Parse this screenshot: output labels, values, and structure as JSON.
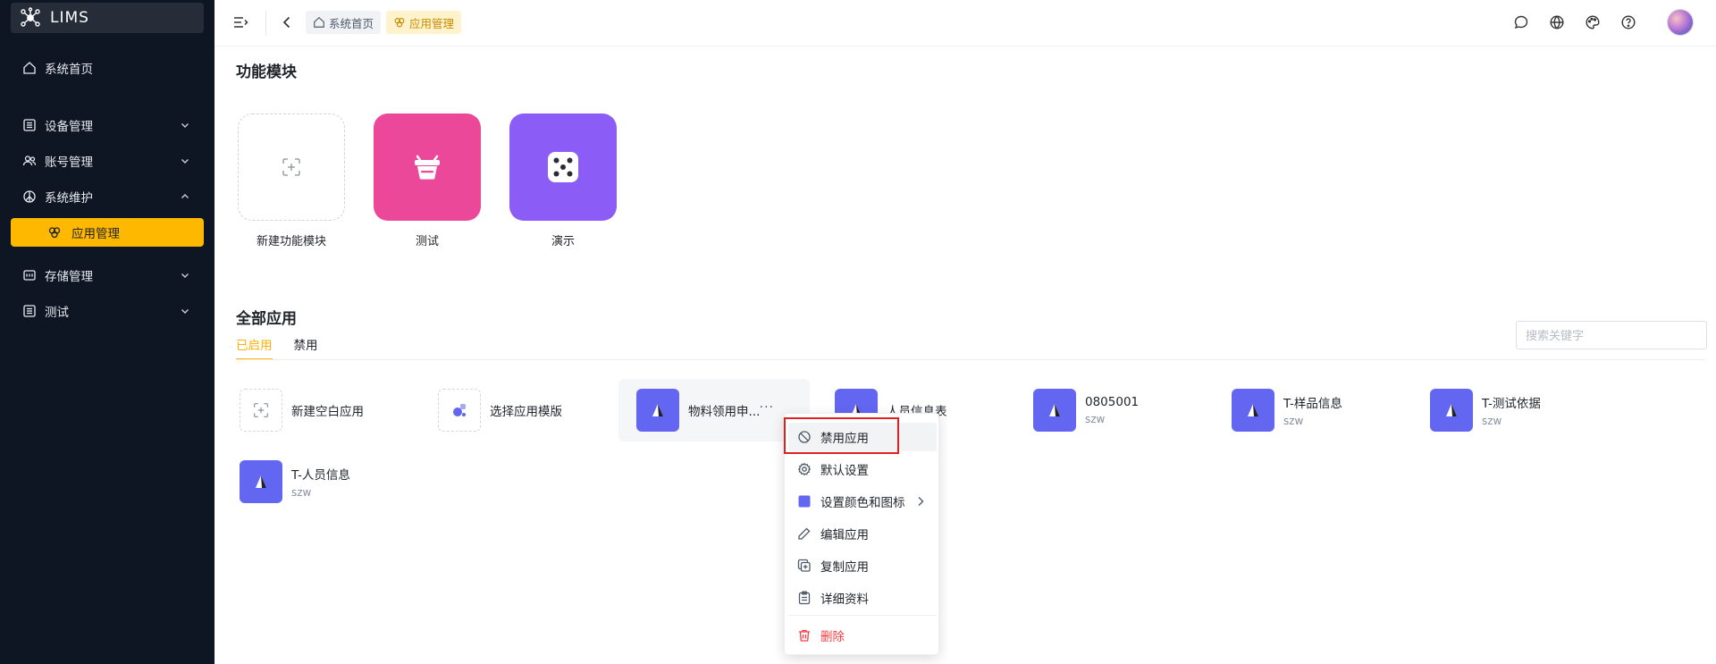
{
  "brand": {
    "name": "LIMS"
  },
  "sidebar": {
    "items": [
      {
        "label": "系统首页",
        "icon": "home-icon"
      },
      {
        "label": "设备管理",
        "icon": "list-icon"
      },
      {
        "label": "账号管理",
        "icon": "users-icon"
      },
      {
        "label": "系统维护",
        "icon": "peace-icon"
      },
      {
        "label": "应用管理",
        "icon": "apps-icon"
      },
      {
        "label": "存储管理",
        "icon": "storage-icon"
      },
      {
        "label": "测试",
        "icon": "list-icon"
      }
    ]
  },
  "header": {
    "breadcrumbs": [
      {
        "label": "系统首页"
      },
      {
        "label": "应用管理"
      }
    ]
  },
  "modules": {
    "title": "功能模块",
    "items": [
      {
        "label": "新建功能模块"
      },
      {
        "label": "测试"
      },
      {
        "label": "演示"
      }
    ]
  },
  "apps": {
    "title": "全部应用",
    "tabs": [
      {
        "label": "已启用"
      },
      {
        "label": "禁用"
      }
    ],
    "search_placeholder": "搜索关键字",
    "items": [
      {
        "name": "新建空白应用",
        "sub": ""
      },
      {
        "name": "选择应用模版",
        "sub": ""
      },
      {
        "name": "物料领用申...",
        "sub": "",
        "more": "···"
      },
      {
        "name": "人员信息表",
        "sub": ""
      },
      {
        "name": "0805001",
        "sub": "szw"
      },
      {
        "name": "T-样品信息",
        "sub": "szw"
      },
      {
        "name": "T-测试依据",
        "sub": "szw"
      },
      {
        "name": "T-人员信息",
        "sub": "szw"
      }
    ]
  },
  "context_menu": {
    "items": [
      {
        "label": "禁用应用"
      },
      {
        "label": "默认设置"
      },
      {
        "label": "设置颜色和图标"
      },
      {
        "label": "编辑应用"
      },
      {
        "label": "复制应用"
      },
      {
        "label": "详细资料"
      },
      {
        "label": "删除"
      }
    ]
  },
  "colors": {
    "accent": "#ffb800",
    "sidebar_bg": "#0f1623",
    "app_icon": "#6366f1",
    "module_pink": "#ec4899",
    "module_purple": "#8b5cf6",
    "danger": "#f53f3f"
  }
}
